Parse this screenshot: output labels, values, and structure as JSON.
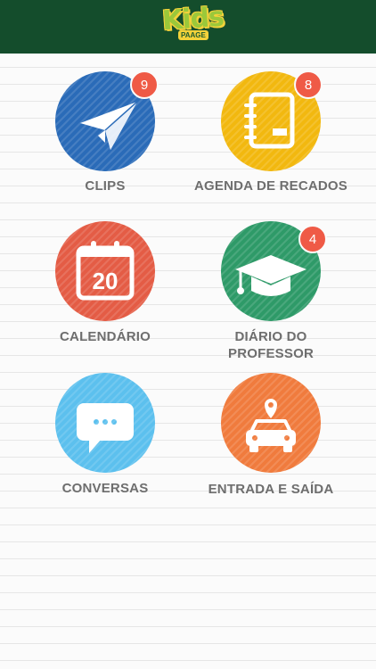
{
  "header": {
    "logo_text": "Kids",
    "logo_sub": "PAAGE",
    "logo_icon": "kids-logo",
    "background": "#144d2c"
  },
  "tiles": [
    {
      "label": "CLIPS",
      "badge": "9",
      "icon": "paper-plane-icon",
      "color": "#2a6bb8"
    },
    {
      "label": "AGENDA DE RECADOS",
      "badge": "8",
      "icon": "notebook-icon",
      "color": "#f2b80f"
    },
    {
      "label": "CALENDÁRIO",
      "badge": "",
      "icon": "calendar-icon",
      "color": "#e45c45",
      "calendar_day": "20"
    },
    {
      "label_line1": "DIÁRIO DO",
      "label_line2": "PROFESSOR",
      "badge": "4",
      "icon": "graduation-cap-icon",
      "color": "#2e9a68"
    },
    {
      "label": "CONVERSAS",
      "badge": "",
      "icon": "chat-bubble-icon",
      "color": "#5cc0ee"
    },
    {
      "label": "ENTRADA E SAÍDA",
      "badge": "",
      "icon": "car-location-icon",
      "color": "#f07b3d"
    }
  ],
  "badge_color": "#ef5a46"
}
